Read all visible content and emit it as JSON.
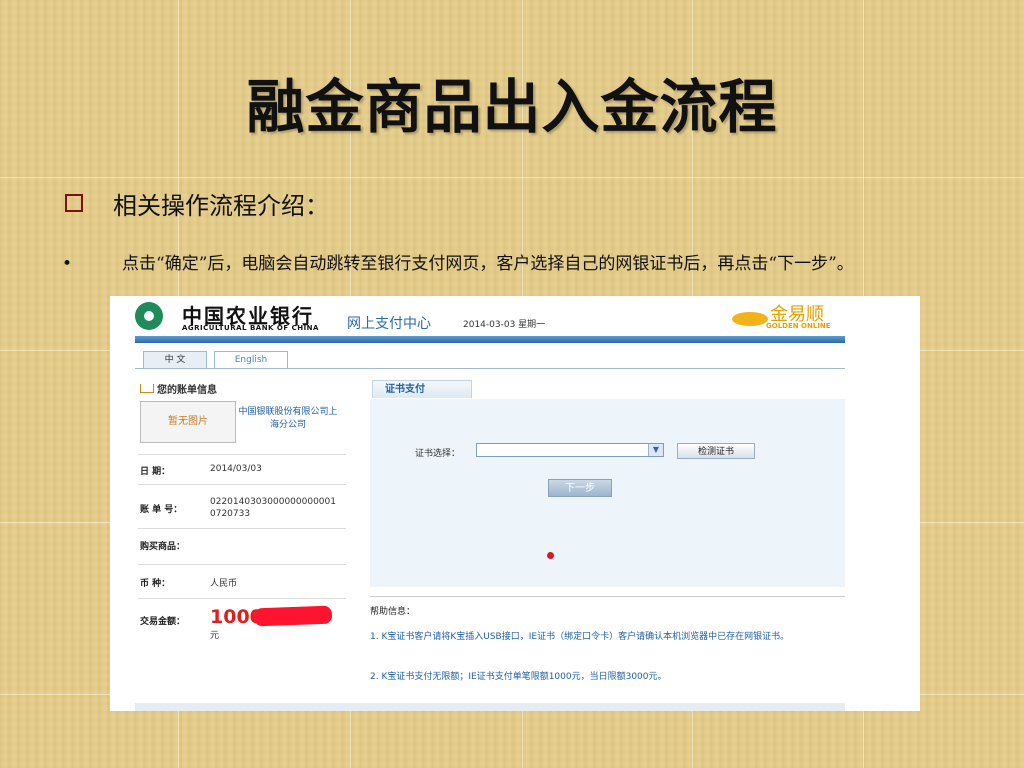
{
  "slide": {
    "title": "融金商品出入金流程",
    "subheading": "相关操作流程介绍：",
    "bullet_marker": "•",
    "bullet_text": "点击“确定”后，电脑会自动跳转至银行支付网页，客户选择自己的网银证书后，再点击“下一步”。"
  },
  "bank_page": {
    "bank_name_cn": "中国农业银行",
    "bank_name_en": "AGRICULTURAL BANK OF CHINA",
    "pay_center": "网上支付中心",
    "date_header": "2014-03-03 星期一",
    "partner_logo_cn": "金易顺",
    "partner_logo_en": "GOLDEN ONLINE",
    "tabs": [
      "中 文",
      "English"
    ],
    "account_info_title": "您的账单信息",
    "merchant_image_placeholder": "暂无图片",
    "merchant_name": "中国银联股份有限公司上海分公司",
    "fields": {
      "date_label": "日 期：",
      "date_value": "2014/03/03",
      "bill_label": "账 单 号：",
      "bill_value": "02201403030000000000010720733",
      "goods_label": "购买商品：",
      "currency_label": "币 种：",
      "currency_value": "人民币",
      "amount_label": "交易金额：",
      "amount_value": "1000",
      "amount_unit": "元"
    },
    "cert_tab": "证书支付",
    "cert_select_label": "证书选择：",
    "detect_button": "检测证书",
    "next_button": "下一步",
    "help_title": "帮助信息：",
    "help_1": "1. K宝证书客户请将K宝插入USB接口，IE证书（绑定口令卡）客户请确认本机浏览器中已存在网银证书。",
    "help_2": "2. K宝证书支付无限额；IE证书支付单笔限额1000元，当日限额3000元。"
  },
  "colors": {
    "background": "#e6cf8e",
    "bank_blue": "#2b6aa8",
    "bank_green": "#1f8a5a",
    "gold": "#e8a000",
    "highlight_red": "#e01e1e"
  }
}
